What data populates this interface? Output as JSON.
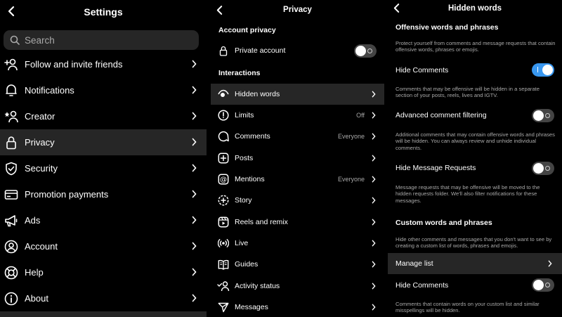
{
  "settings": {
    "title": "Settings",
    "search_placeholder": "Search",
    "items": [
      {
        "label": "Follow and invite friends"
      },
      {
        "label": "Notifications"
      },
      {
        "label": "Creator"
      },
      {
        "label": "Privacy"
      },
      {
        "label": "Security"
      },
      {
        "label": "Promotion payments"
      },
      {
        "label": "Ads"
      },
      {
        "label": "Account"
      },
      {
        "label": "Help"
      },
      {
        "label": "About"
      }
    ]
  },
  "privacy": {
    "title": "Privacy",
    "account_privacy_header": "Account privacy",
    "private_account_label": "Private account",
    "interactions_header": "Interactions",
    "items": [
      {
        "label": "Hidden words",
        "value": ""
      },
      {
        "label": "Limits",
        "value": "Off"
      },
      {
        "label": "Comments",
        "value": "Everyone"
      },
      {
        "label": "Posts",
        "value": ""
      },
      {
        "label": "Mentions",
        "value": "Everyone"
      },
      {
        "label": "Story",
        "value": ""
      },
      {
        "label": "Reels and remix",
        "value": ""
      },
      {
        "label": "Live",
        "value": ""
      },
      {
        "label": "Guides",
        "value": ""
      },
      {
        "label": "Activity status",
        "value": ""
      },
      {
        "label": "Messages",
        "value": ""
      }
    ]
  },
  "hidden_words": {
    "title": "Hidden words",
    "offensive_header": "Offensive words and phrases",
    "offensive_desc": "Protect yourself from comments and message requests that contain offensive words, phrases or emojis.",
    "hide_comments_label": "Hide Comments",
    "hide_comments_desc": "Comments that may be offensive will be hidden in a separate section of your posts, reels, lives and IGTV.",
    "advanced_label": "Advanced comment filtering",
    "advanced_desc": "Additional comments that may contain offensive words and phrases will be hidden. You can always review and unhide individual comments.",
    "hide_requests_label": "Hide Message Requests",
    "hide_requests_desc": "Message requests that may be offensive will be moved to the hidden requests folder. We'll also filter notifications for these messages.",
    "custom_header": "Custom words and phrases",
    "custom_desc": "Hide other comments and messages that you don't want to see by creating a custom list of words, phrases and emojis.",
    "manage_list_label": "Manage list",
    "hide_comments_custom_label": "Hide Comments",
    "hide_comments_custom_desc": "Comments that contain words on your custom list and similar misspellings will be hidden."
  },
  "colors": {
    "toggle_on": "#3897f0",
    "active_row": "#262626",
    "secondary_text": "#a8a8a8"
  },
  "icons": [
    "chevron-left-icon",
    "search-icon",
    "add-person-icon",
    "bell-icon",
    "creator-icon",
    "lock-icon",
    "shield-icon",
    "card-icon",
    "megaphone-icon",
    "account-icon",
    "lifebuoy-icon",
    "info-icon",
    "eye-icon",
    "alert-icon",
    "comment-icon",
    "plus-icon",
    "at-icon",
    "story-icon",
    "reels-icon",
    "live-icon",
    "guides-icon",
    "activity-icon",
    "send-icon",
    "chevron-right-icon"
  ]
}
